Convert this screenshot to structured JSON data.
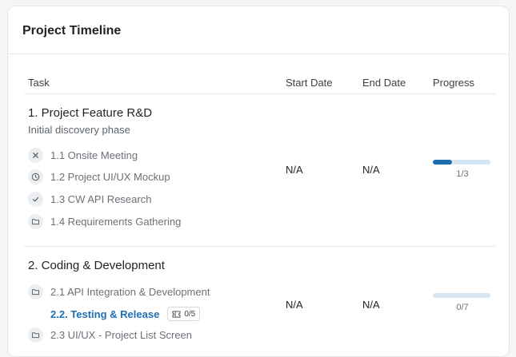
{
  "card": {
    "title": "Project Timeline"
  },
  "table": {
    "headers": {
      "task": "Task",
      "start": "Start Date",
      "end": "End Date",
      "progress": "Progress"
    }
  },
  "groups": [
    {
      "title": "1. Project Feature R&D",
      "subtitle": "Initial discovery phase",
      "start": "N/A",
      "end": "N/A",
      "progress_label": "1/3",
      "progress_value": 0.333,
      "items": [
        {
          "label": "1.1 Onsite Meeting",
          "icon": "close-icon"
        },
        {
          "label": "1.2 Project UI/UX Mockup",
          "icon": "clock-icon"
        },
        {
          "label": "1.3 CW API Research",
          "icon": "check-icon"
        },
        {
          "label": "1.4 Requirements Gathering",
          "icon": "folder-icon"
        }
      ]
    },
    {
      "title": "2. Coding & Development",
      "start": "N/A",
      "end": "N/A",
      "progress_label": "0/7",
      "progress_value": 0,
      "items": [
        {
          "label": "2.1 API Integration & Development",
          "icon": "folder-icon"
        },
        {
          "label": "2.2. Testing & Release",
          "badge": "0/5",
          "badge_icon": "ticket-icon",
          "active": true
        },
        {
          "label": "2.3 UI/UX - Project List Screen",
          "icon": "folder-icon"
        }
      ]
    }
  ],
  "colors": {
    "accent": "#1d6eb0",
    "track": "#d6e6f3",
    "active_link": "#1f6fb5"
  }
}
